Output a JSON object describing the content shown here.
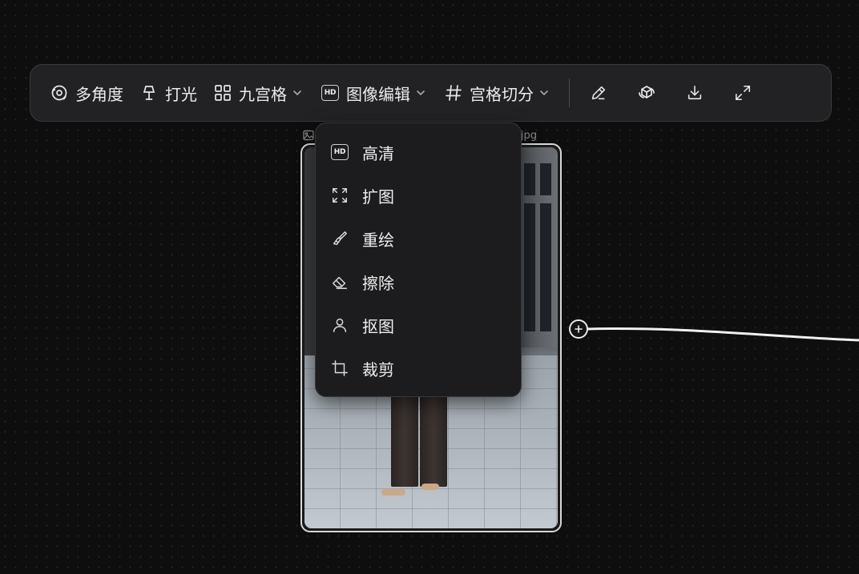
{
  "toolbar": {
    "items": [
      {
        "label": "多角度",
        "icon": "multi-angle-icon"
      },
      {
        "label": "打光",
        "icon": "lamp-icon"
      },
      {
        "label": "九宫格",
        "icon": "grid-icon",
        "has_dropdown": true
      },
      {
        "label": "图像编辑",
        "icon": "hd-icon",
        "has_dropdown": true,
        "expanded": true
      },
      {
        "label": "宫格切分",
        "icon": "hash-icon",
        "has_dropdown": true
      }
    ],
    "hd_badge_text": "HD",
    "icon_buttons": [
      "pencil-icon",
      "rotate-3d-icon",
      "download-icon",
      "expand-icon"
    ]
  },
  "node": {
    "filename_suffix": "jpg"
  },
  "dropdown": {
    "items": [
      {
        "label": "高清",
        "icon": "hd-icon",
        "badge": "HD"
      },
      {
        "label": "扩图",
        "icon": "expand-frame-icon"
      },
      {
        "label": "重绘",
        "icon": "brush-icon"
      },
      {
        "label": "擦除",
        "icon": "eraser-icon"
      },
      {
        "label": "抠图",
        "icon": "person-icon"
      },
      {
        "label": "裁剪",
        "icon": "crop-icon"
      }
    ]
  },
  "colors": {
    "background": "#0e0e0e",
    "toolbar_bg": "#222224",
    "dropdown_bg": "#1c1c1e",
    "text": "#ececec",
    "border": "#d7d7d7"
  }
}
